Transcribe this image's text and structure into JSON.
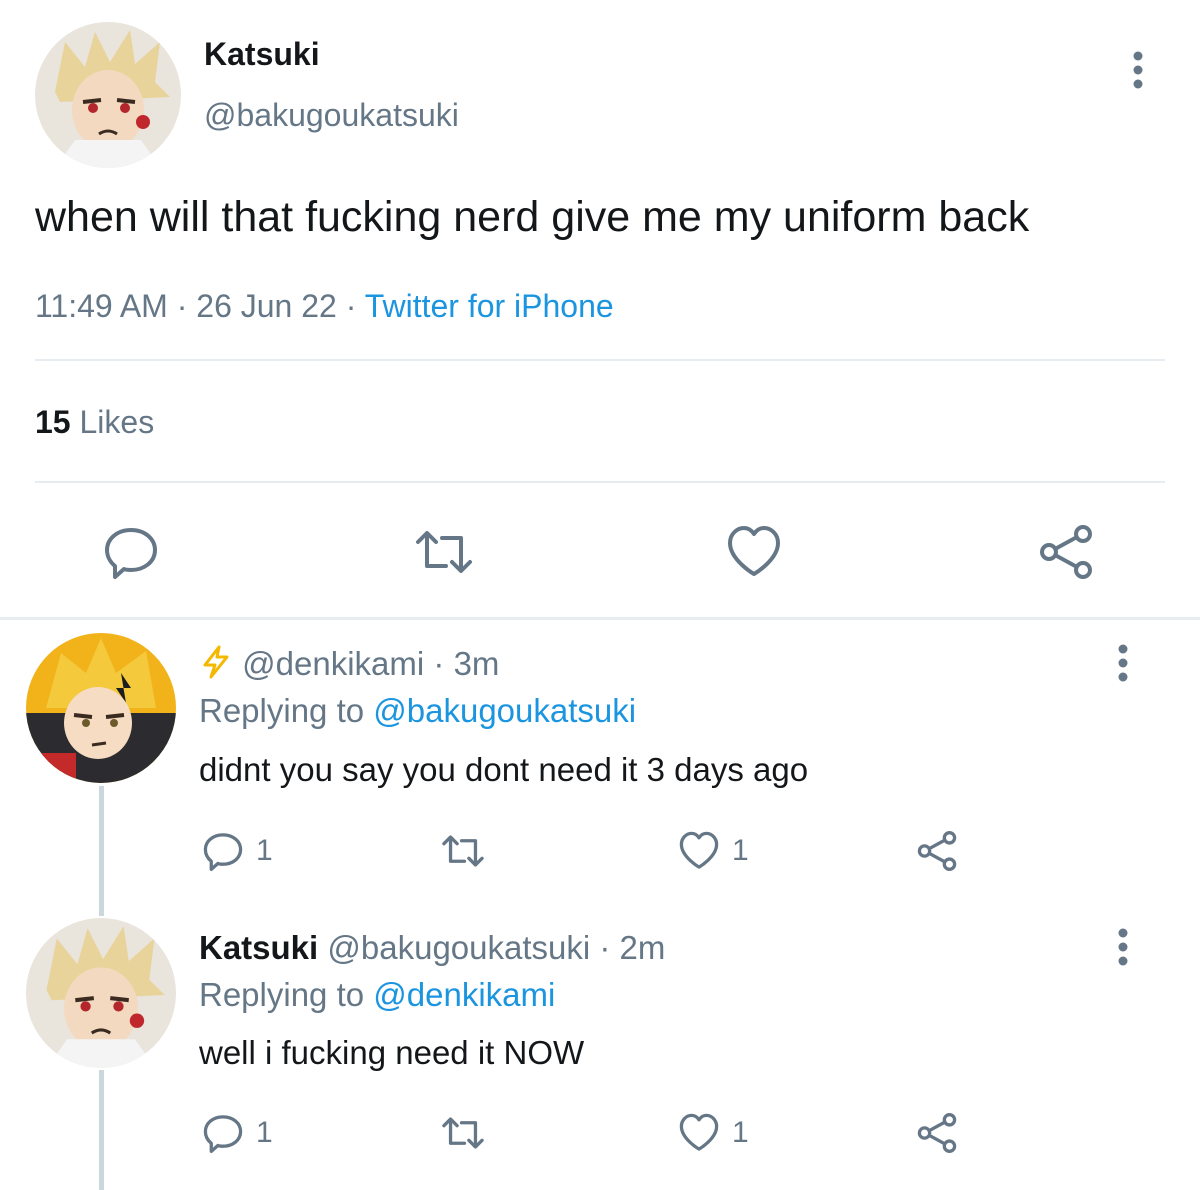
{
  "main_tweet": {
    "avatar": "katsuki-avatar",
    "display_name": "Katsuki",
    "handle": "@bakugoukatsuki",
    "text": "when will that fucking nerd give me my uniform back",
    "time": "11:49 AM",
    "sep1": " · ",
    "date": "26 Jun 22",
    "sep2": " · ",
    "source": "Twitter for iPhone",
    "likes_count": "15",
    "likes_label": "Likes",
    "actions": [
      "reply-icon",
      "retweet-icon",
      "like-icon",
      "share-icon"
    ]
  },
  "replies": [
    {
      "avatar": "denki-avatar",
      "badge_icon": "lightning-icon",
      "display_name": "",
      "handle": "@denkikami",
      "time_sep": " · ",
      "time": "3m",
      "replying_prefix": "Replying to ",
      "replying_to": "@bakugoukatsuki",
      "text": "didnt you say you dont need it 3 days ago",
      "reply_count": "1",
      "like_count": "1"
    },
    {
      "avatar": "katsuki-avatar",
      "display_name": "Katsuki",
      "handle": "@bakugoukatsuki",
      "time_sep": " · ",
      "time": "2m",
      "replying_prefix": "Replying to ",
      "replying_to": "@denkikami",
      "text": "well i fucking need it NOW",
      "reply_count": "1",
      "like_count": "1"
    }
  ],
  "colors": {
    "link": "#1b95e0",
    "muted": "#657786",
    "text": "#14171a",
    "divider": "#e6ecf0",
    "icon": "#657786"
  }
}
